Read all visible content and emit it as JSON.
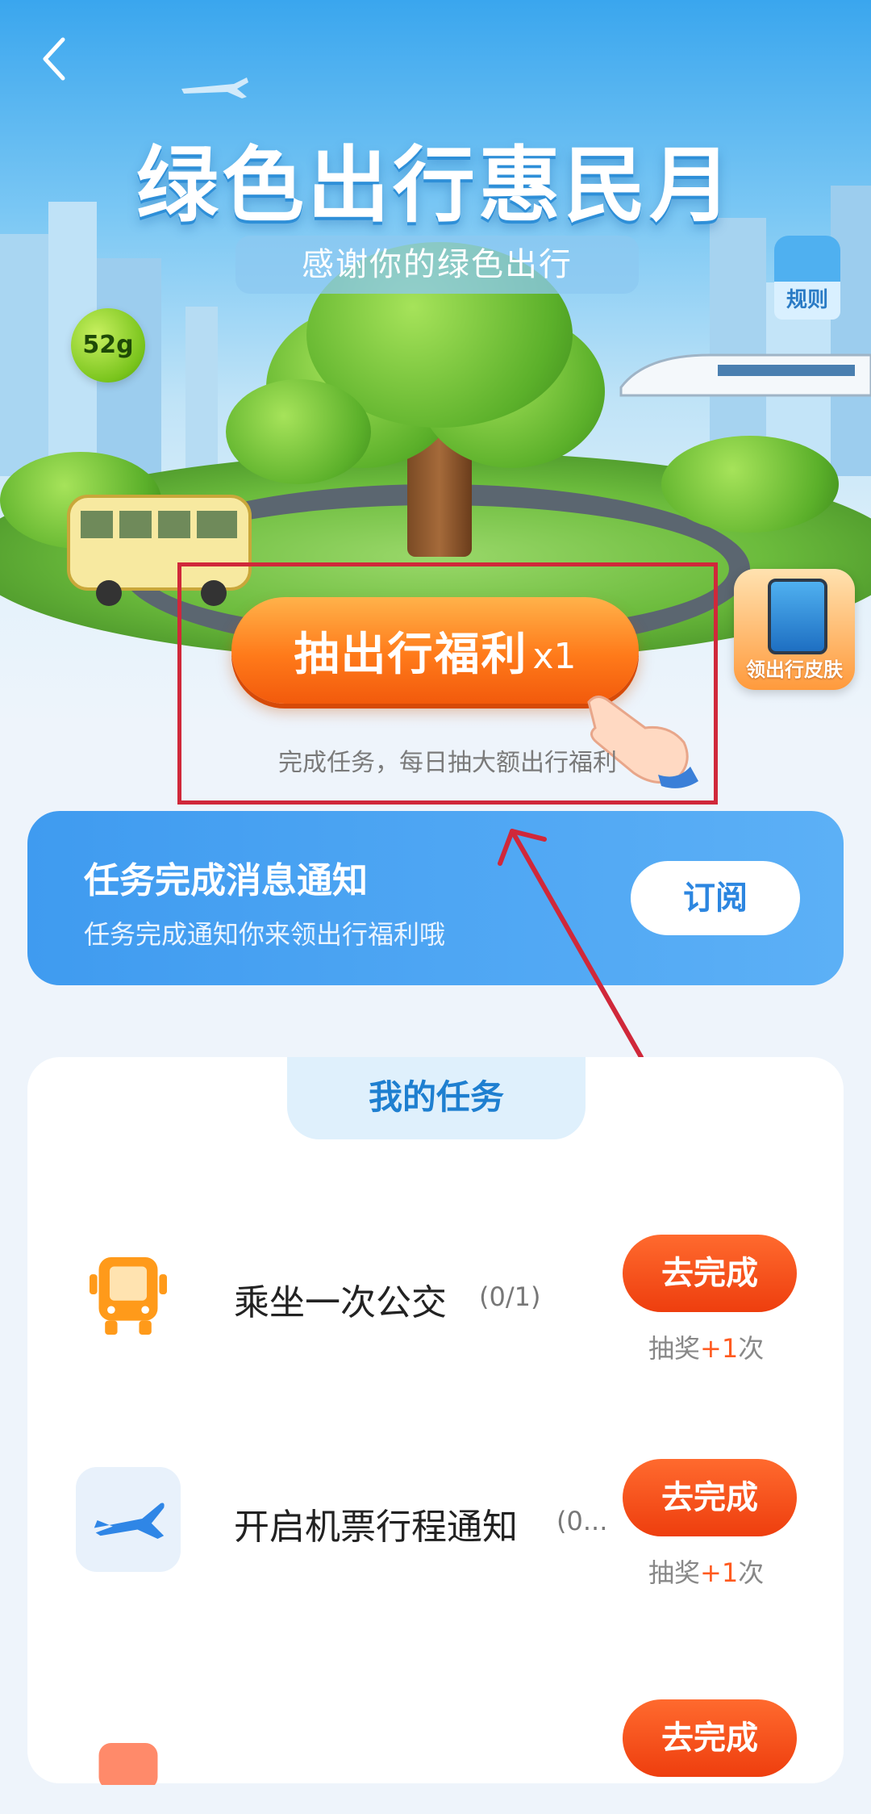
{
  "hero": {
    "title": "绿色出行惠民月",
    "subtitle": "感谢你的绿色出行",
    "co2_badge": "52g",
    "rules_label": "规则",
    "skin_label": "领出行皮肤"
  },
  "draw": {
    "label": "抽出行福利",
    "count": "x1",
    "subtitle": "完成任务，每日抽大额出行福利"
  },
  "notify": {
    "title": "任务完成消息通知",
    "subtitle": "任务完成通知你来领出行福利哦",
    "button_label": "订阅"
  },
  "tasks": {
    "tab_label": "我的任务",
    "items": [
      {
        "name": "乘坐一次公交",
        "progress": "(0/1)",
        "button": "去完成",
        "reward_prefix": "抽奖",
        "reward_plus": "+1",
        "reward_suffix": "次",
        "icon": "bus-icon"
      },
      {
        "name": "开启机票行程通知",
        "progress": "(0...",
        "button": "去完成",
        "reward_prefix": "抽奖",
        "reward_plus": "+1",
        "reward_suffix": "次",
        "icon": "airplane-icon"
      },
      {
        "name": "",
        "progress": "",
        "button": "去完成",
        "icon": "task-icon"
      }
    ]
  },
  "colors": {
    "accent_orange": "#ff6a2e",
    "notify_blue": "#3f9bf0",
    "highlight_red": "#d0283a",
    "tab_blue": "#1e7fd0"
  }
}
